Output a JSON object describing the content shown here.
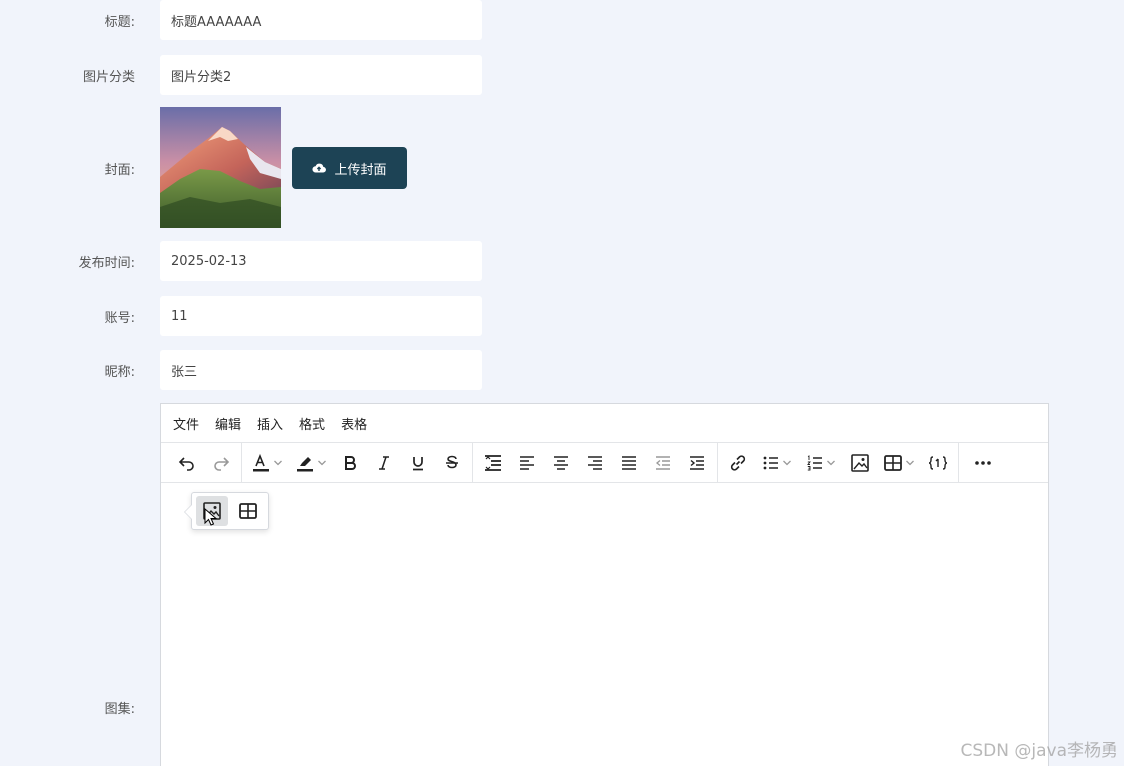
{
  "form": {
    "title_label": "标题:",
    "title_value": "标题AAAAAAA",
    "category_label": "图片分类",
    "category_value": "图片分类2",
    "cover_label": "封面:",
    "upload_button": "上传封面",
    "publish_time_label": "发布时间:",
    "publish_time_value": "2025-02-13",
    "account_label": "账号:",
    "account_value": "11",
    "nickname_label": "昵称:",
    "nickname_value": "张三",
    "gallery_label": "图集:"
  },
  "editor": {
    "menu": [
      "文件",
      "编辑",
      "插入",
      "格式",
      "表格"
    ]
  },
  "watermark": "CSDN @java李杨勇",
  "colors": {
    "background": "#f1f4fb",
    "upload_button": "#1d4355",
    "toolbar_icon": "#222222"
  },
  "icons": {
    "toolbar": [
      "undo-icon",
      "redo-icon",
      "text-color-icon",
      "highlight-color-icon",
      "bold-icon",
      "italic-icon",
      "underline-icon",
      "strikethrough-icon",
      "line-height-icon",
      "align-left-icon",
      "align-center-icon",
      "align-right-icon",
      "align-justify-icon",
      "outdent-icon",
      "indent-icon",
      "link-icon",
      "bullet-list-icon",
      "numbered-list-icon",
      "image-icon",
      "table-icon",
      "code-sample-icon",
      "more-icon"
    ],
    "popup": [
      "image-icon",
      "table-icon"
    ]
  }
}
